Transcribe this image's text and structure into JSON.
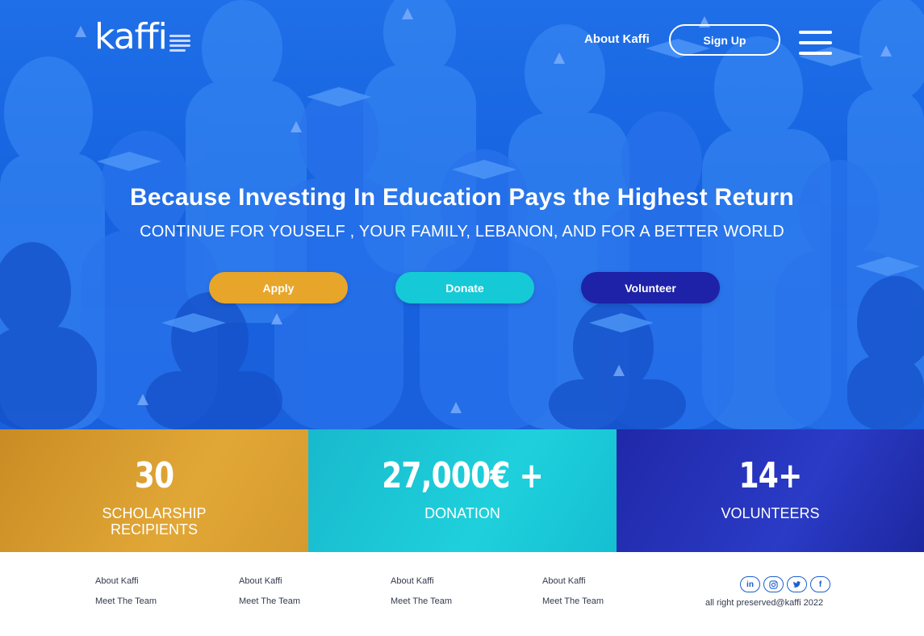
{
  "brand": {
    "logo_text": "kaffi"
  },
  "nav": {
    "about_label": "About Kaffi",
    "signup_label": "Sign Up",
    "menu_icon": "hamburger-menu-icon"
  },
  "hero": {
    "title": "Because Investing In Education Pays the Highest Return",
    "subtitle": "CONTINUE FOR YOUSELF , YOUR FAMILY, LEBANON, AND FOR A BETTER WORLD",
    "buttons": [
      {
        "label": "Apply",
        "color": "#e7a52a"
      },
      {
        "label": "Donate",
        "color": "#16c9d6"
      },
      {
        "label": "Volunteer",
        "color": "#1d22a8"
      }
    ]
  },
  "stats": [
    {
      "value": "30",
      "label": "SCHOLARSHIP\nRECIPIENTS",
      "color": "#e1a736"
    },
    {
      "value": "27,000€ +",
      "label": "DONATION",
      "color": "#1fd0dc"
    },
    {
      "value": "14+",
      "label": "VOLUNTEERS",
      "color": "#2a3bc6"
    }
  ],
  "footer": {
    "columns": [
      {
        "links": [
          "About Kaffi",
          "Meet The Team"
        ]
      },
      {
        "links": [
          "About Kaffi",
          "Meet The Team"
        ]
      },
      {
        "links": [
          "About Kaffi",
          "Meet The Team"
        ]
      },
      {
        "links": [
          "About Kaffi",
          "Meet The Team"
        ]
      }
    ],
    "socials": [
      {
        "icon": "linkedin-icon",
        "glyph": "in"
      },
      {
        "icon": "instagram-icon",
        "glyph": ""
      },
      {
        "icon": "twitter-icon",
        "glyph": ""
      },
      {
        "icon": "facebook-icon",
        "glyph": "f"
      }
    ],
    "copyright": "all right preserved@kaffi 2022"
  }
}
